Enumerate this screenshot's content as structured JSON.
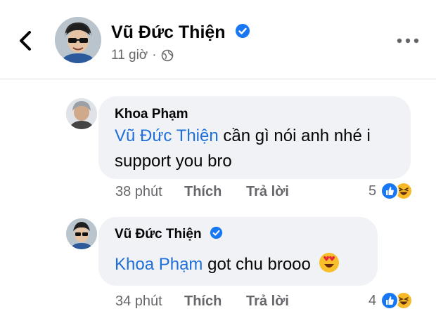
{
  "header": {
    "name": "Vũ Đức Thiện",
    "time": "11 giờ",
    "separator": "·",
    "icons": {
      "back": "chevron-left-icon",
      "verified": "verified-badge-icon",
      "privacy": "globe-icon",
      "more": "more-horizontal-icon"
    }
  },
  "comments": [
    {
      "author": "Khoa Phạm",
      "mention": "Vũ Đức Thiện",
      "text_line1_rest": " cần gì nói anh nhé i",
      "text_line2": "support you bro",
      "time": "38 phút",
      "like_label": "Thích",
      "reply_label": "Trả lời",
      "reaction_count": "5",
      "reaction_icons": [
        "like-reaction-icon",
        "haha-reaction-icon"
      ]
    },
    {
      "author": "Vũ Đức Thiện",
      "verified": true,
      "mention": "Khoa Phạm",
      "text_rest": " got chu brooo",
      "emoji": "heart-eyes-emoji",
      "time": "34 phút",
      "like_label": "Thích",
      "reply_label": "Trả lời",
      "reaction_count": "4",
      "reaction_icons": [
        "like-reaction-icon",
        "haha-reaction-icon"
      ]
    }
  ],
  "colors": {
    "mention": "#1e6fd9",
    "bubble": "#f0f2f5",
    "secondary_text": "#65676b",
    "verified": "#1877f2",
    "like": "#1877f2",
    "haha": "#f7b928"
  }
}
